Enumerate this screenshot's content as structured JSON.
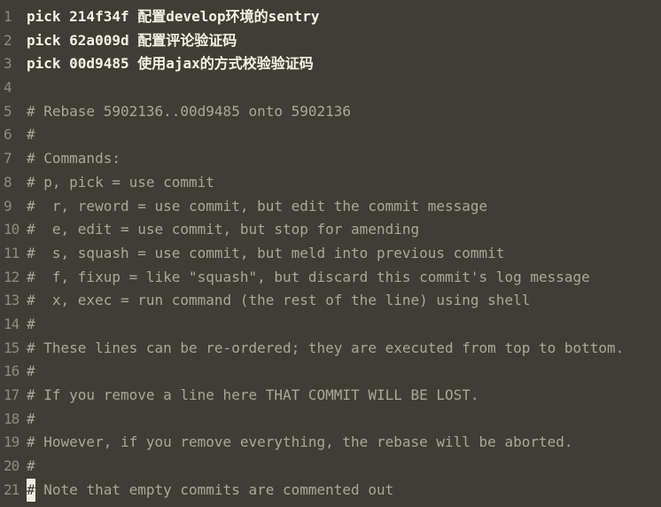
{
  "editor": {
    "lines": [
      {
        "num": "1",
        "text": "pick 214f34f 配置develop环境的sentry",
        "kind": "pick"
      },
      {
        "num": "2",
        "text": "pick 62a009d 配置评论验证码",
        "kind": "pick"
      },
      {
        "num": "3",
        "text": "pick 00d9485 使用ajax的方式校验验证码",
        "kind": "pick"
      },
      {
        "num": "4",
        "text": "",
        "kind": "blank"
      },
      {
        "num": "5",
        "text": "# Rebase 5902136..00d9485 onto 5902136",
        "kind": "comment"
      },
      {
        "num": "6",
        "text": "#",
        "kind": "comment"
      },
      {
        "num": "7",
        "text": "# Commands:",
        "kind": "comment"
      },
      {
        "num": "8",
        "text": "# p, pick = use commit",
        "kind": "comment"
      },
      {
        "num": "9",
        "text": "#  r, reword = use commit, but edit the commit message",
        "kind": "comment"
      },
      {
        "num": "10",
        "text": "#  e, edit = use commit, but stop for amending",
        "kind": "comment"
      },
      {
        "num": "11",
        "text": "#  s, squash = use commit, but meld into previous commit",
        "kind": "comment"
      },
      {
        "num": "12",
        "text": "#  f, fixup = like \"squash\", but discard this commit's log message",
        "kind": "comment"
      },
      {
        "num": "13",
        "text": "#  x, exec = run command (the rest of the line) using shell",
        "kind": "comment"
      },
      {
        "num": "14",
        "text": "#",
        "kind": "comment"
      },
      {
        "num": "15",
        "text": "# These lines can be re-ordered; they are executed from top to bottom.",
        "kind": "comment"
      },
      {
        "num": "16",
        "text": "#",
        "kind": "comment"
      },
      {
        "num": "17",
        "text": "# If you remove a line here THAT COMMIT WILL BE LOST.",
        "kind": "comment"
      },
      {
        "num": "18",
        "text": "#",
        "kind": "comment"
      },
      {
        "num": "19",
        "text": "# However, if you remove everything, the rebase will be aborted.",
        "kind": "comment"
      },
      {
        "num": "20",
        "text": "#",
        "kind": "comment"
      },
      {
        "num": "21",
        "text": " Note that empty commits are commented out",
        "kind": "comment",
        "cursor_char": "#"
      }
    ]
  }
}
